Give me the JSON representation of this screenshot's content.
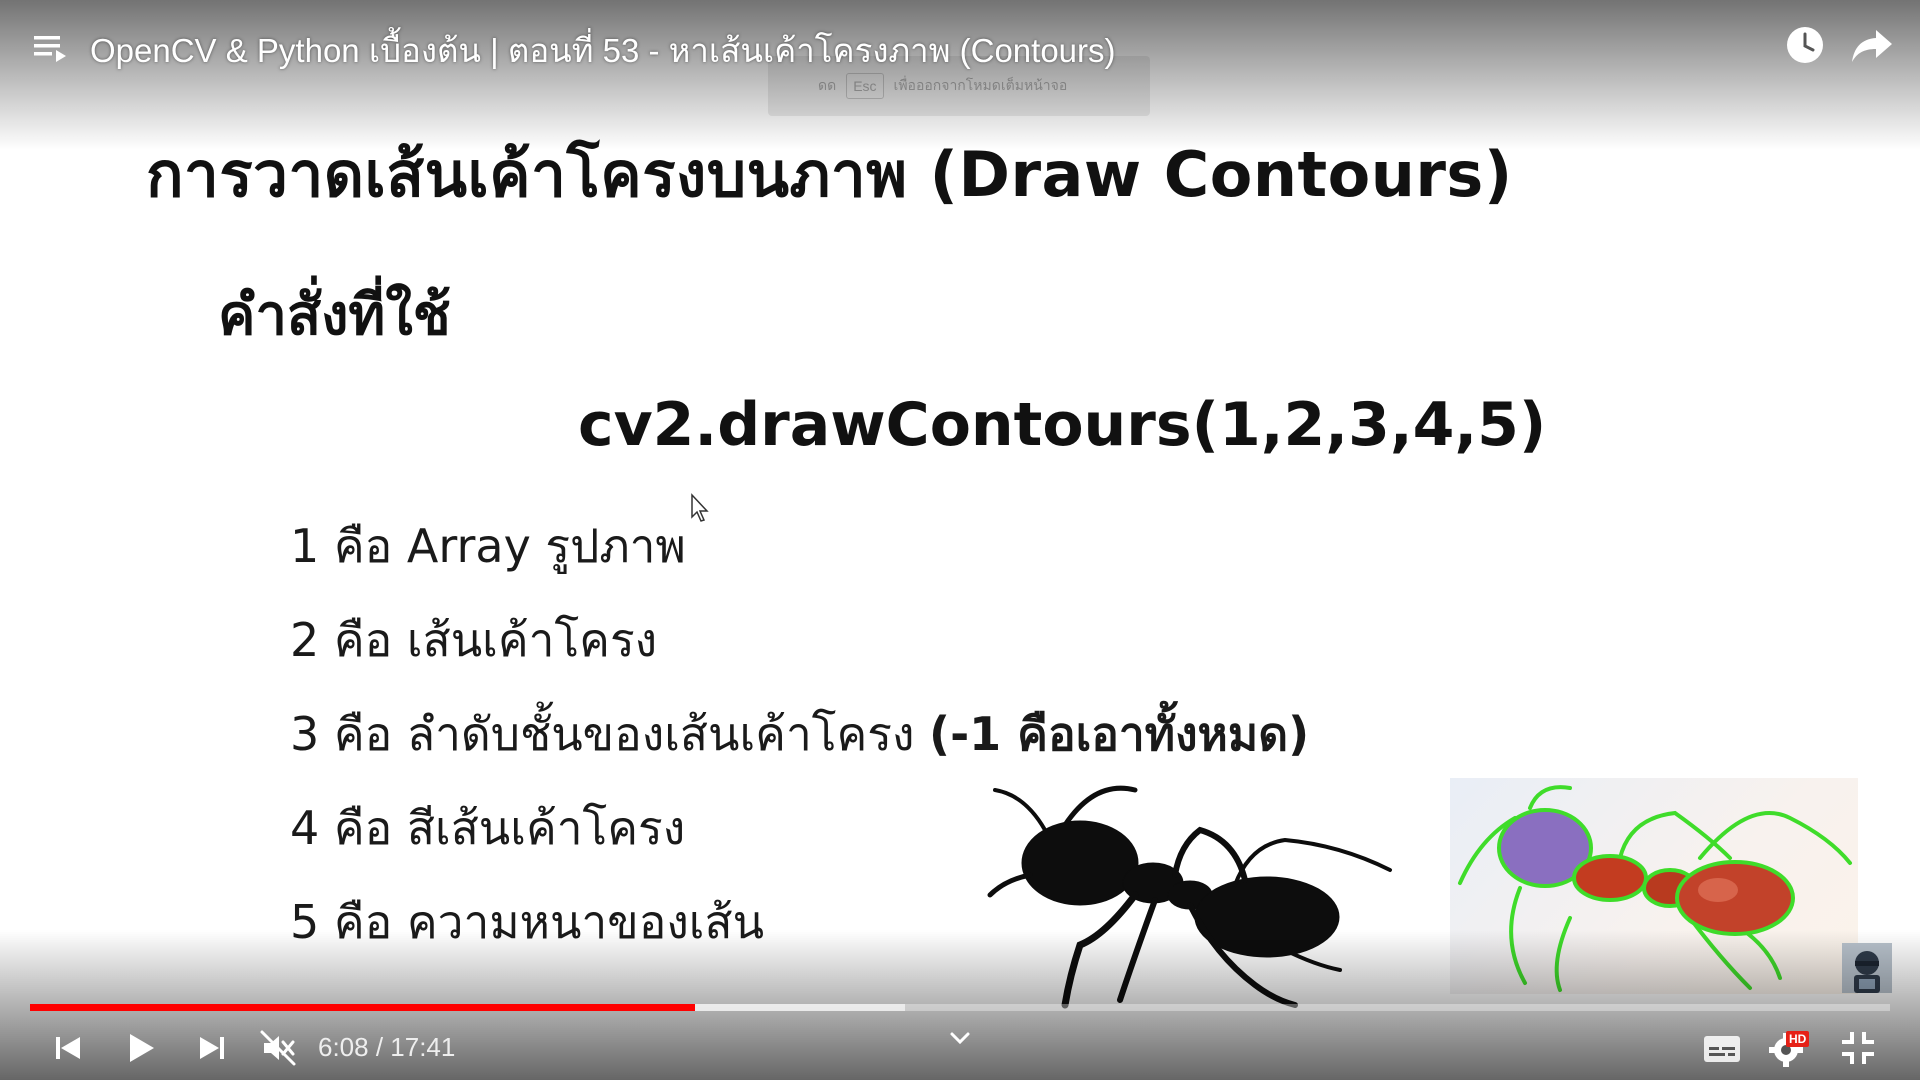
{
  "header": {
    "video_title": "OpenCV & Python เบื้องต้น | ตอนที่ 53 - หาเส้นเค้าโครงภาพ (Contours)"
  },
  "esc_hint": {
    "key_left": "ดด",
    "key": "Esc",
    "text": "เพื่อออกจากโหมดเต็มหน้าจอ"
  },
  "slide": {
    "title": "การวาดเส้นเค้าโครงบนภาพ (Draw Contours)",
    "subtitle": "คำสั่งที่ใช้",
    "command": "cv2.drawContours(1,2,3,4,5)",
    "params": [
      {
        "text": "1 คือ Array รูปภาพ",
        "bold_suffix": ""
      },
      {
        "text": "2 คือ เส้นเค้าโครง",
        "bold_suffix": ""
      },
      {
        "text": "3 คือ ลำดับชั้นของเส้นเค้าโครง ",
        "bold_suffix": "(-1 คือเอาทั้งหมด)"
      },
      {
        "text": "4 คือ สีเส้นเค้าโครง",
        "bold_suffix": ""
      },
      {
        "text": "5 คือ ความหนาของเส้น",
        "bold_suffix": ""
      }
    ]
  },
  "player": {
    "current_time": "6:08",
    "separator": " / ",
    "duration": "17:41",
    "progress_played": 0.3575,
    "progress_buffered": 0.4705,
    "hd_label": "HD",
    "accent_color": "#ff0000"
  },
  "icons": [
    "playlist-icon",
    "clock-icon",
    "share-icon",
    "previous-icon",
    "play-icon",
    "next-icon",
    "mute-icon",
    "chevron-down-icon",
    "subtitles-icon",
    "settings-icon",
    "exit-fullscreen-icon"
  ]
}
